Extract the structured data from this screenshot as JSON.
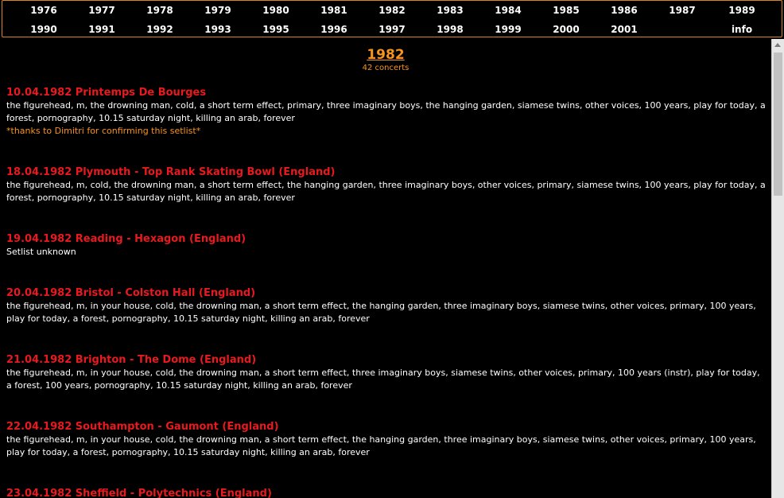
{
  "nav": {
    "row1": [
      "1976",
      "1977",
      "1978",
      "1979",
      "1980",
      "1981",
      "1982",
      "1983",
      "1984",
      "1985",
      "1986",
      "1987",
      "1989"
    ],
    "row2": [
      "1990",
      "1991",
      "1992",
      "1993",
      "1995",
      "1996",
      "1997",
      "1998",
      "1999",
      "2000",
      "2001",
      "",
      "info"
    ]
  },
  "year": {
    "title": "1982",
    "subtitle": "42 concerts"
  },
  "concerts": [
    {
      "title": "10.04.1982 Printemps De Bourges",
      "setlist": "the figurehead, m, the drowning man, cold, a short term effect, primary, three imaginary boys, the hanging garden, siamese twins, other voices, 100 years, play for today, a forest, pornography, 10.15 saturday night, killing an arab, forever",
      "note": "*thanks to Dimitri for confirming this setlist*"
    },
    {
      "title": "18.04.1982 Plymouth - Top Rank Skating Bowl (England)",
      "setlist": "the figurehead, m, cold, the drowning man, a short term effect, the hanging garden, three imaginary boys, other voices, primary, siamese twins, 100 years, play for today, a forest, pornography, 10.15 saturday night, killing an arab, forever"
    },
    {
      "title": "19.04.1982 Reading - Hexagon (England)",
      "setlist": "Setlist unknown"
    },
    {
      "title": "20.04.1982 Bristol - Colston Hall (England)",
      "setlist": "the figurehead, m, in your house, cold, the drowning man, a short term effect, the hanging garden, three imaginary boys, siamese twins, other voices, primary, 100 years, play for today, a forest, pornography, 10.15 saturday night, killing an arab, forever"
    },
    {
      "title": "21.04.1982 Brighton - The Dome (England)",
      "setlist": "the figurehead, m, in your house, cold, the drowning man, a short term effect, three imaginary boys, siamese twins, other voices, primary, 100 years (instr), play for today, a forest, 100 years, pornography, 10.15 saturday night, killing an arab, forever"
    },
    {
      "title": "22.04.1982 Southampton - Gaumont (England)",
      "setlist": "the figurehead, m, in your house, cold, the drowning man, a short term effect, the hanging garden, three imaginary boys, siamese twins, other voices, primary, 100 years, play for today, a forest, pornography, 10.15 saturday night, killing an arab, forever"
    },
    {
      "title": "23.04.1982 Sheffield - Polytechnics (England)",
      "setlist": ""
    }
  ]
}
